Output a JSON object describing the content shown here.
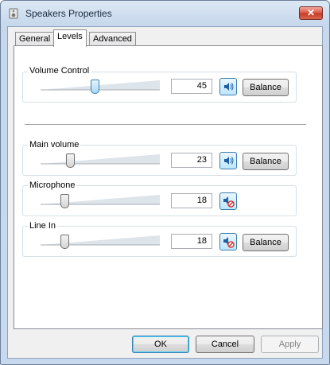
{
  "window": {
    "title": "Speakers Properties",
    "close_glyph": "✕"
  },
  "tabs": [
    {
      "label": "General"
    },
    {
      "label": "Levels"
    },
    {
      "label": "Advanced"
    }
  ],
  "controls": [
    {
      "label": "Volume Control",
      "value": "45",
      "level": 0.45,
      "muted": false,
      "balance_label": "Balance"
    },
    {
      "label": "Main volume",
      "value": "23",
      "level": 0.23,
      "muted": false,
      "balance_label": "Balance"
    },
    {
      "label": "Microphone",
      "value": "18",
      "level": 0.18,
      "muted": true
    },
    {
      "label": "Line In",
      "value": "18",
      "level": 0.18,
      "muted": true,
      "balance_label": "Balance"
    }
  ],
  "buttons": {
    "ok": "OK",
    "cancel": "Cancel",
    "apply": "Apply"
  },
  "icons": {
    "title": "speaker-icon",
    "speaker": "speaker-icon",
    "muted": "speaker-muted-icon"
  }
}
